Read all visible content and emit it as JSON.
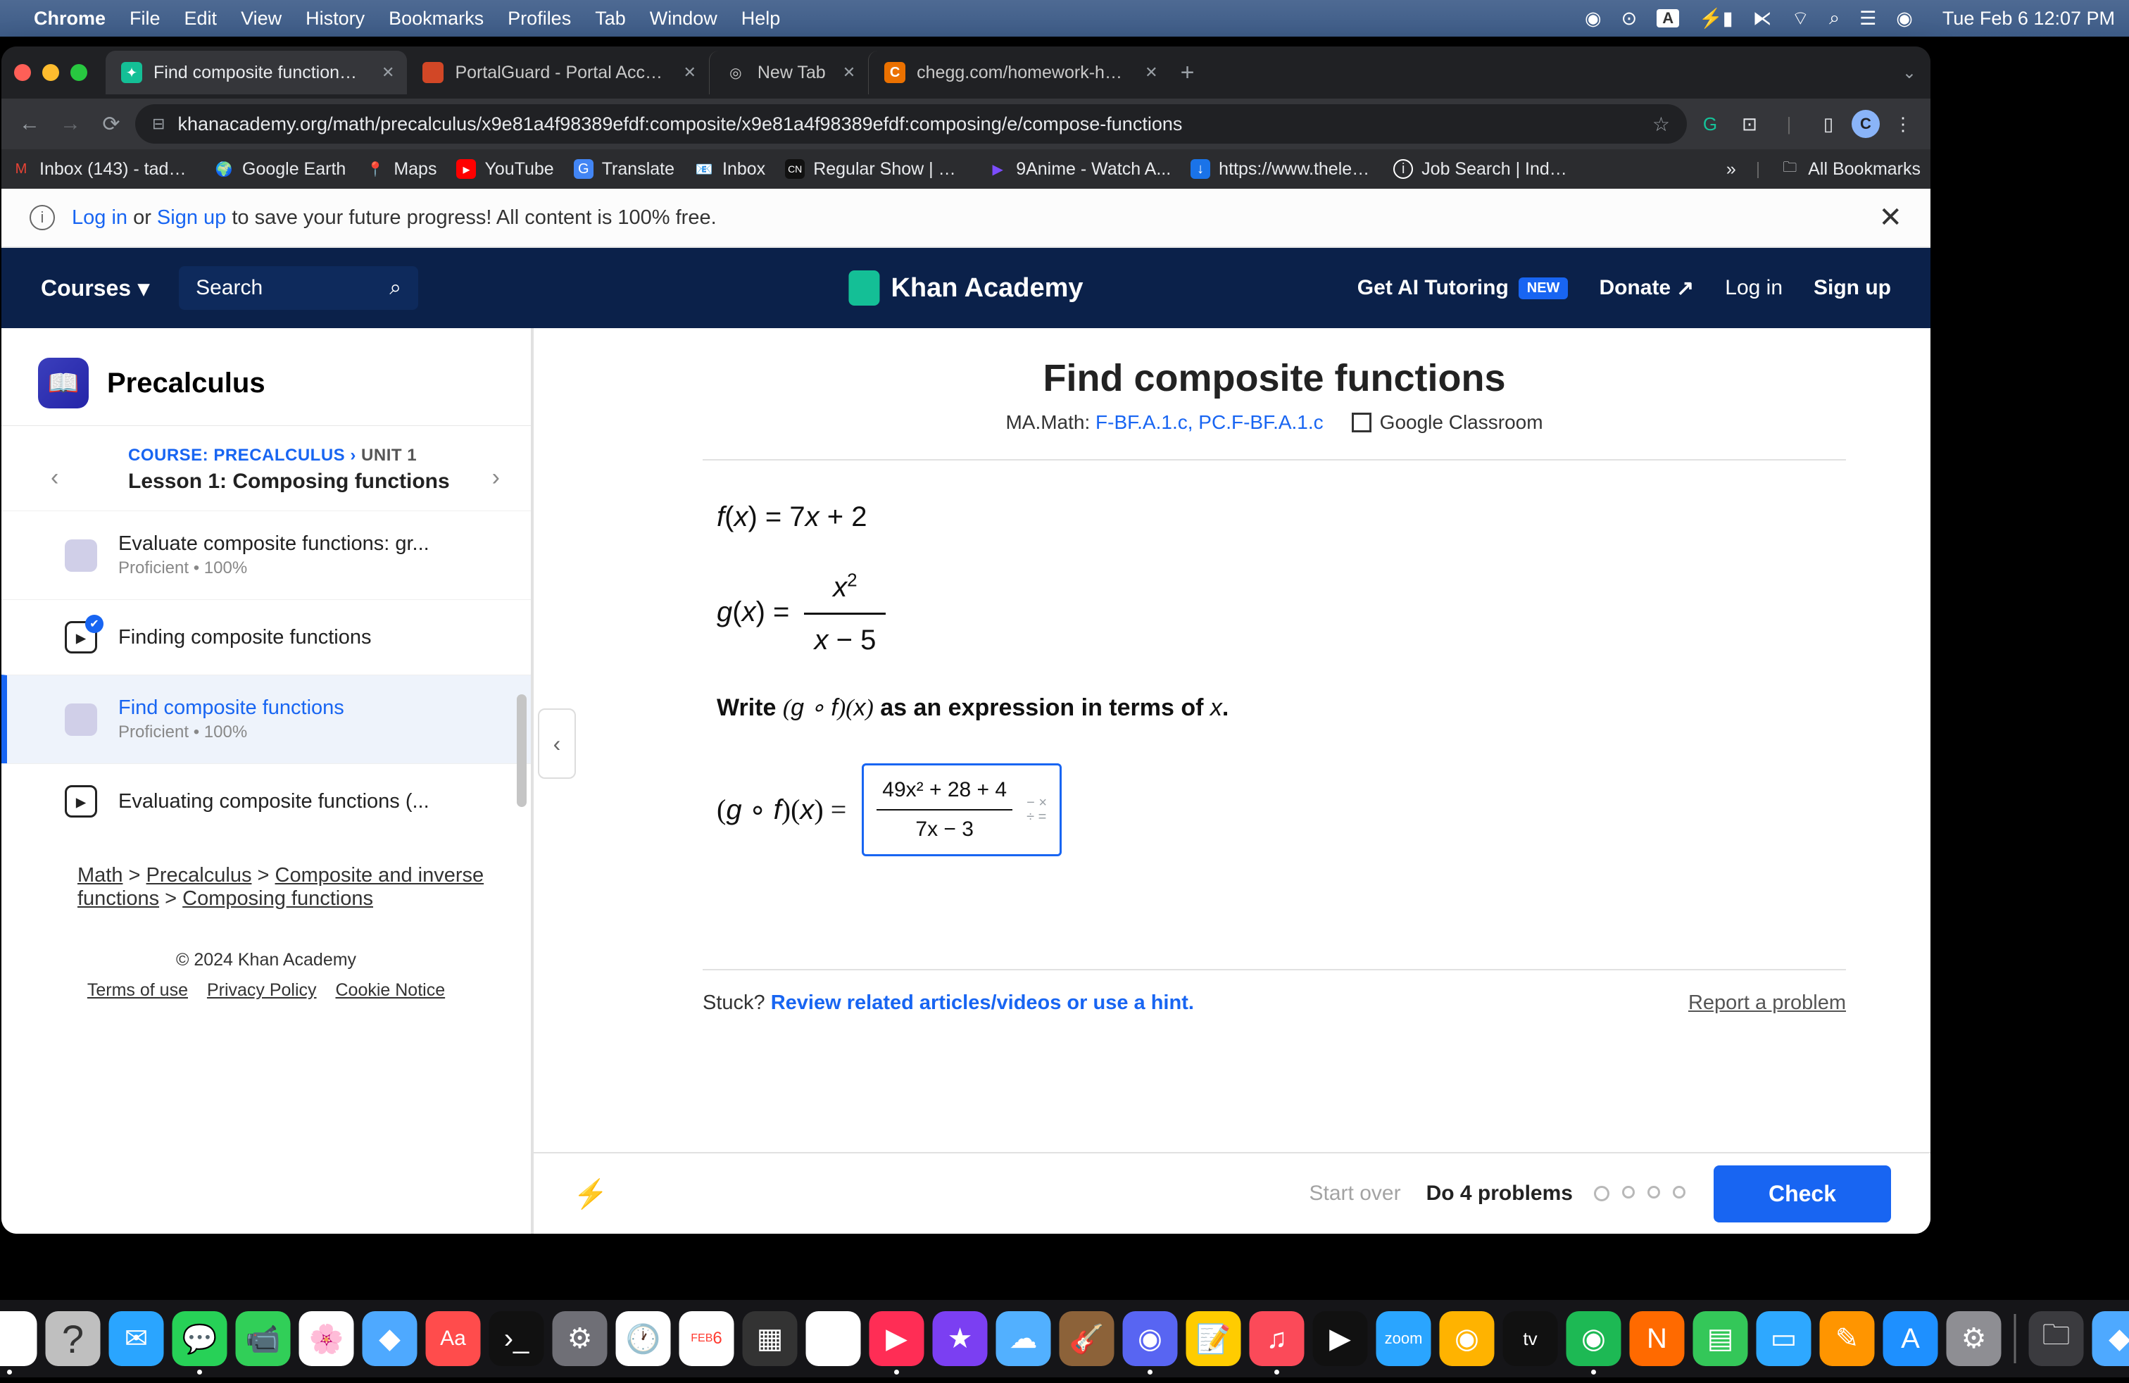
{
  "mac_menu": {
    "app": "Chrome",
    "items": [
      "File",
      "Edit",
      "View",
      "History",
      "Bookmarks",
      "Profiles",
      "Tab",
      "Window",
      "Help"
    ],
    "clock": "Tue Feb 6  12:07 PM"
  },
  "tabs": [
    {
      "title": "Find composite functions (pra",
      "favicon": "🟢",
      "active": true
    },
    {
      "title": "PortalGuard - Portal Access",
      "favicon": "🟧",
      "active": false
    },
    {
      "title": "New Tab",
      "favicon": "◎",
      "active": false
    },
    {
      "title": "chegg.com/homework-help/q",
      "favicon": "C",
      "active": false
    }
  ],
  "url": "khanacademy.org/math/precalculus/x9e81a4f98389efdf:composite/x9e81a4f98389efdf:composing/e/compose-functions",
  "bookmarks": [
    {
      "icon": "M",
      "txt": "Inbox (143) - tadel...",
      "c": "#ea4335"
    },
    {
      "icon": "🌍",
      "txt": "Google Earth",
      "c": "#4285f4"
    },
    {
      "icon": "📍",
      "txt": "Maps",
      "c": "#34a853"
    },
    {
      "icon": "▶",
      "txt": "YouTube",
      "c": "#ff0000"
    },
    {
      "icon": "🔤",
      "txt": "Translate",
      "c": "#4285f4"
    },
    {
      "icon": "📧",
      "txt": "Inbox",
      "c": "#6e6e6e"
    },
    {
      "icon": "CN",
      "txt": "Regular Show | Wa...",
      "c": "#111"
    },
    {
      "icon": "▶",
      "txt": "9Anime - Watch A...",
      "c": "#7c4dff"
    },
    {
      "icon": "⬇",
      "txt": "https://www.theles...",
      "c": "#1a73e8"
    },
    {
      "icon": "ⓘ",
      "txt": "Job Search | Indeed",
      "c": "#2557a7"
    }
  ],
  "all_bookmarks": "All Bookmarks",
  "banner": {
    "prefix": "",
    "login": "Log in",
    "or": " or ",
    "signup": "Sign up",
    "suffix": " to save your future progress! All content is 100% free."
  },
  "ka_header": {
    "courses": "Courses",
    "search": "Search",
    "brand": "Khan Academy",
    "ai": "Get AI Tutoring",
    "new": "NEW",
    "donate": "Donate",
    "login": "Log in",
    "signup": "Sign up"
  },
  "sidebar": {
    "course": "Precalculus",
    "bc_course": "COURSE: PRECALCULUS",
    "bc_unit": "UNIT 1",
    "lesson": "Lesson 1: Composing functions",
    "items": [
      {
        "title": "Evaluate composite functions: gr...",
        "sub": "Proficient • 100%",
        "icon": "sq"
      },
      {
        "title": "Finding composite functions",
        "icon": "vid-done"
      },
      {
        "title": "Find composite functions",
        "sub": "Proficient • 100%",
        "icon": "sq",
        "active": true
      },
      {
        "title": "Evaluating composite functions (...",
        "icon": "vid"
      }
    ],
    "crumbs": {
      "a": "Math",
      "b": "Precalculus",
      "c": "Composite and inverse functions",
      "d": "Composing functions"
    },
    "copyright": "© 2024 Khan Academy",
    "footer": [
      "Terms of use",
      "Privacy Policy",
      "Cookie Notice"
    ]
  },
  "content": {
    "title": "Find composite functions",
    "standards_label": "MA.Math:",
    "standards_links": "F-BF.A.1.c, PC.F-BF.A.1.c",
    "gc": "Google Classroom",
    "f_lhs": "f(x) = 7x + 2",
    "g_lhs": "g(x) =",
    "g_num": "x",
    "g_num_sup": "2",
    "g_den": "x − 5",
    "instr_a": "Write ",
    "instr_math": "(g ∘ f)(x)",
    "instr_b": " as an expression in terms of ",
    "instr_x": "x",
    "instr_dot": ".",
    "ans_lhs": "(g ∘ f)(x) =",
    "ans_num": "49x² + 28 + 4",
    "ans_den": "7x − 3",
    "stuck_label": "Stuck? ",
    "stuck_link": "Review related articles/videos or use a hint.",
    "report": "Report a problem"
  },
  "actionbar": {
    "startover": "Start over",
    "do": "Do 4 problems",
    "check": "Check"
  }
}
